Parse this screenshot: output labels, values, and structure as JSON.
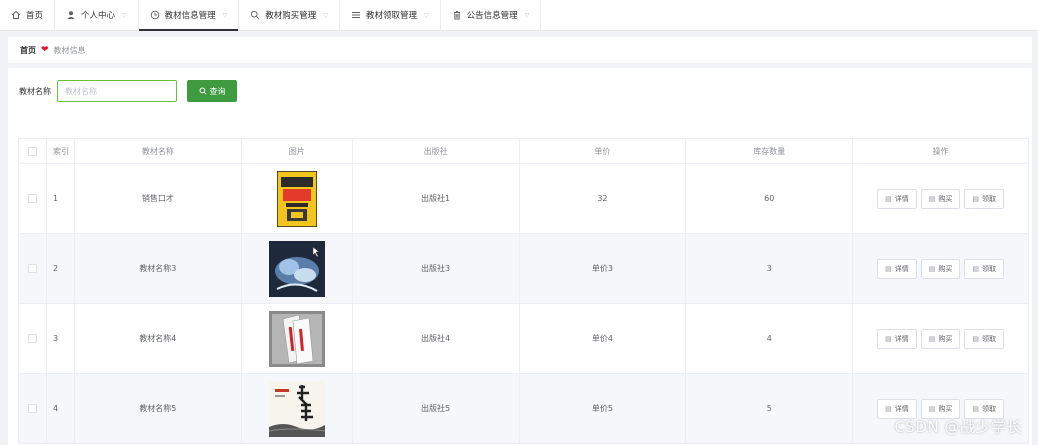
{
  "nav": {
    "items": [
      {
        "label": "首页",
        "icon": "home-icon",
        "has_dropdown": false
      },
      {
        "label": "个人中心",
        "icon": "user-icon",
        "has_dropdown": true
      },
      {
        "label": "教材信息管理",
        "icon": "clock-icon",
        "has_dropdown": true,
        "active": true
      },
      {
        "label": "教材购买管理",
        "icon": "search-icon",
        "has_dropdown": true
      },
      {
        "label": "教材领取管理",
        "icon": "list-icon",
        "has_dropdown": true
      },
      {
        "label": "公告信息管理",
        "icon": "trash-icon",
        "has_dropdown": true
      }
    ]
  },
  "breadcrumb": {
    "home": "首页",
    "current": "教材信息"
  },
  "search": {
    "label": "教材名称",
    "placeholder": "教材名称",
    "button_label": "查询"
  },
  "table": {
    "headers": {
      "index": "索引",
      "name": "教材名称",
      "image": "图片",
      "publisher": "出版社",
      "price": "单价",
      "stock": "库存数量",
      "ops": "操作"
    },
    "rows": [
      {
        "index": "1",
        "name": "销售口才",
        "image": "book-cover-yellow",
        "publisher": "出版社1",
        "price": "32",
        "stock": "60"
      },
      {
        "index": "2",
        "name": "教材名称3",
        "image": "book-cover-dark-art",
        "publisher": "出版社3",
        "price": "单价3",
        "stock": "3"
      },
      {
        "index": "3",
        "name": "教材名称4",
        "image": "book-cover-red-white",
        "publisher": "出版社4",
        "price": "单价4",
        "stock": "4"
      },
      {
        "index": "4",
        "name": "教材名称5",
        "image": "book-cover-calligraphy",
        "publisher": "出版社5",
        "price": "单价5",
        "stock": "5"
      }
    ],
    "ops": {
      "detail": "详情",
      "buy": "购买",
      "receive": "领取"
    }
  },
  "watermark": "CSDN @战少学长",
  "colors": {
    "primary_green": "#3f9b40",
    "input_border": "#67c23a",
    "heart_red": "#e0162b",
    "stripe": "#f5f7fa"
  }
}
